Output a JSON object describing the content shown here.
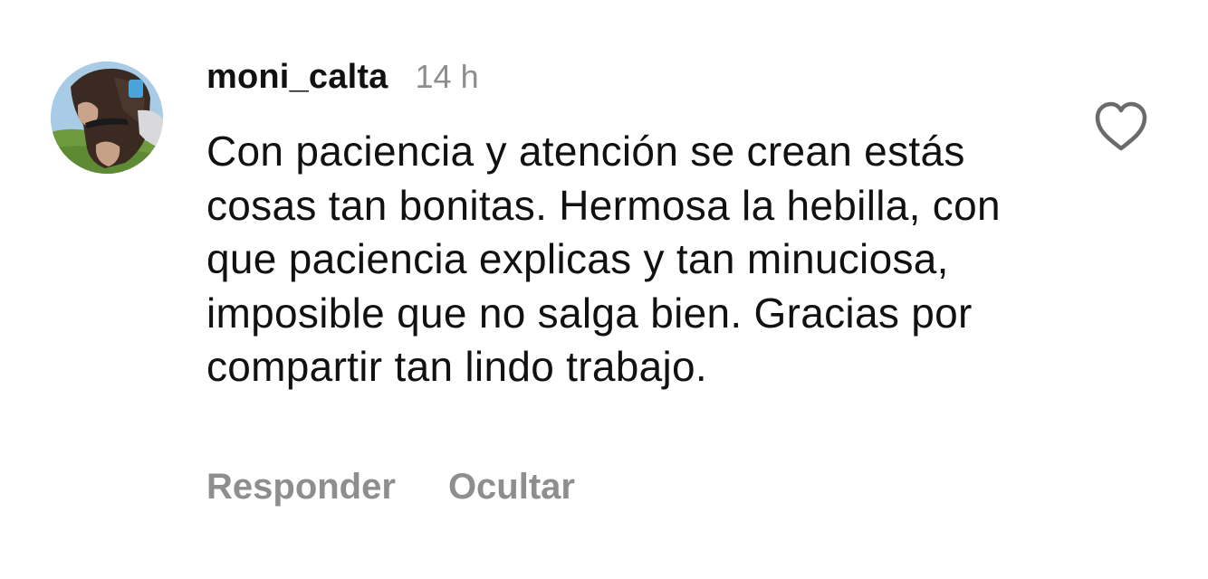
{
  "comment": {
    "username": "moni_calta",
    "time": "14 h",
    "text": "Con paciencia y atención se crean estás cosas tan bonitas. Hermosa la hebilla, con que paciencia explicas y tan minuciosa, imposible que no salga bien. Gracias por compartir tan lindo trabajo.",
    "actions": {
      "reply": "Responder",
      "hide": "Ocultar"
    },
    "like_icon": "heart-outline-icon"
  },
  "colors": {
    "text": "#111111",
    "muted": "#8e8e8e",
    "background": "#ffffff",
    "icon": "#6b6b6b"
  }
}
